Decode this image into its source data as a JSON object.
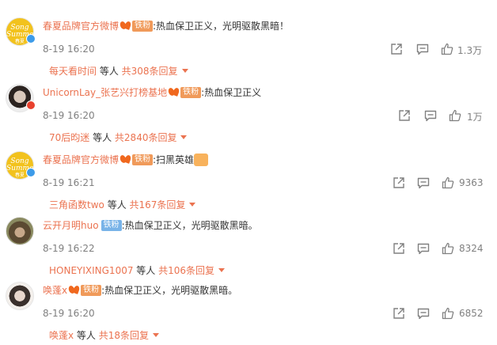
{
  "like_icon": "thumbs-up-icon",
  "share_icon": "share-icon",
  "comment_icon": "comment-icon",
  "accent_color": "#eb7350",
  "comments": [
    {
      "avatar_text": [
        "Song",
        "Summer",
        "春夏"
      ],
      "username": "春夏品牌官方微博",
      "tag": "铁粉",
      "text": ":热血保卫正义，光明驱散黑暗！",
      "time": "8-19 16:20",
      "likes": "1.3万",
      "reply_user": "每天看时间",
      "reply_mid": " 等人 ",
      "reply_count": "共308条回复"
    },
    {
      "username": "UnicornLay_张艺兴打榜基地",
      "tag": "铁粉",
      "text": ":热血保卫正义",
      "time": "8-19 16:20",
      "likes": "1万",
      "reply_user": "70后昀迷",
      "reply_mid": " 等人 ",
      "reply_count": "共2840条回复"
    },
    {
      "avatar_text": [
        "Song",
        "Summer",
        "春夏"
      ],
      "username": "春夏品牌官方微博",
      "tag": "铁粉",
      "text": ":扫黑英雄",
      "time": "8-19 16:21",
      "likes": "9363",
      "reply_user": "三角函数two",
      "reply_mid": " 等人 ",
      "reply_count": "共167条回复"
    },
    {
      "username": "云开月明huo",
      "tag": "铁粉",
      "text": ":热血保卫正义，光明驱散黑暗。",
      "time": "8-19 16:22",
      "likes": "8324",
      "reply_user": "HONEYIXING1007",
      "reply_mid": " 等人 ",
      "reply_count": "共106条回复"
    },
    {
      "username": "唤蓬x",
      "tag": "铁粉",
      "text": ":热血保卫正义，光明驱散黑暗。",
      "time": "8-19 16:20",
      "likes": "6852",
      "reply_user": "唤蓬x",
      "reply_mid": " 等人 ",
      "reply_count": "共18条回复"
    }
  ]
}
